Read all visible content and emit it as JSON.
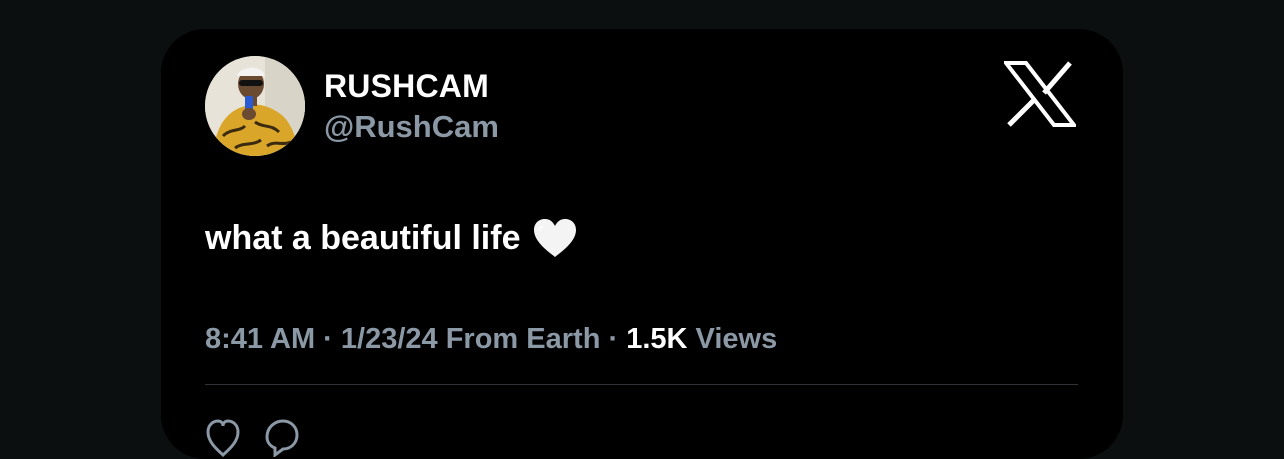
{
  "user": {
    "display_name": "RUSHCAM",
    "handle": "@RushCam"
  },
  "tweet": {
    "text": "what a beautiful life",
    "emoji_icon": "white-heart-icon"
  },
  "meta": {
    "time": "8:41 AM",
    "separator1": " · ",
    "date_location": "1/23/24 From Earth",
    "separator2": " · ",
    "views_count": "1.5K",
    "views_label": " Views"
  },
  "brand": {
    "logo_icon": "x-logo-icon"
  },
  "colors": {
    "background": "#0b0f0f",
    "card": "#000000",
    "text_primary": "#ffffff",
    "text_secondary": "#8b98a5",
    "divider": "#2f3336"
  }
}
